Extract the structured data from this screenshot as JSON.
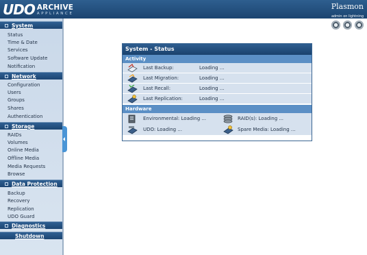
{
  "header": {
    "logo_udo": "UDO",
    "logo_archive": "ARCHIVE",
    "logo_appliance": "APPLIANCE",
    "brand": "Plasmon",
    "login_text": "admin on lightning"
  },
  "toolbar": {
    "buttons": [
      "round-button-1",
      "round-button-2",
      "round-button-3"
    ]
  },
  "sidebar": {
    "sections": [
      {
        "label": "System",
        "items": [
          "Status",
          "Time & Date",
          "Services",
          "Software Update",
          "Notification"
        ]
      },
      {
        "label": "Network",
        "items": [
          "Configuration",
          "Users",
          "Groups",
          "Shares",
          "Authentication"
        ]
      },
      {
        "label": "Storage",
        "items": [
          "RAIDs",
          "Volumes",
          "Online Media",
          "Offline Media",
          "Media Requests",
          "Browse"
        ]
      },
      {
        "label": "Data Protection",
        "items": [
          "Backup",
          "Recovery",
          "Replication",
          "UDO Guard"
        ]
      },
      {
        "label": "Diagnostics",
        "items": []
      },
      {
        "label": "Shutdown",
        "items": []
      }
    ]
  },
  "panel": {
    "title": "System - Status",
    "activity_header": "Activity",
    "activity": [
      {
        "label": "Last Backup:",
        "value": "Loading ..."
      },
      {
        "label": "Last Migration:",
        "value": "Loading ..."
      },
      {
        "label": "Last Recall:",
        "value": "Loading ..."
      },
      {
        "label": "Last Replication:",
        "value": "Loading ..."
      }
    ],
    "hardware_header": "Hardware",
    "hardware": [
      {
        "label": "Environmental:  Loading ..."
      },
      {
        "label": "RAID(s):  Loading ..."
      },
      {
        "label": "UDO:  Loading ..."
      },
      {
        "label": "Spare Media:  Loading ..."
      }
    ]
  }
}
